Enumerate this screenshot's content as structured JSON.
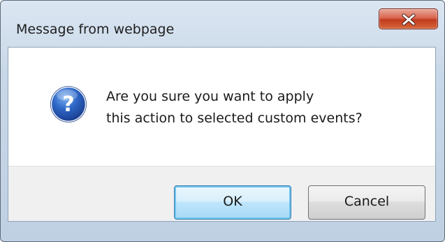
{
  "dialog": {
    "title": "Message from webpage",
    "message": "Are you sure you want to apply\nthis action to selected custom events?",
    "icon": "question-icon",
    "ok_label": "OK",
    "cancel_label": "Cancel",
    "close_icon": "close-icon"
  },
  "colors": {
    "accent": "#2f68c8",
    "close_button": "#c23a20",
    "ok_border": "#3c7fb1"
  }
}
